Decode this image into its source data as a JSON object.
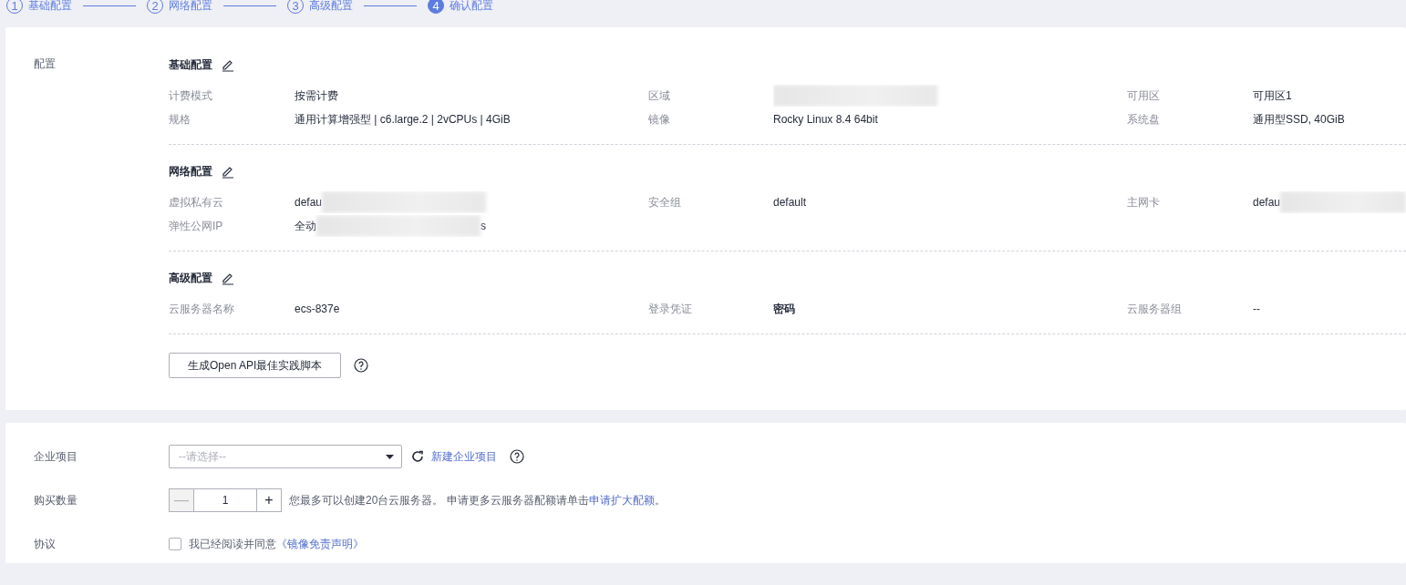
{
  "steps": [
    {
      "number": "1",
      "label": "基础配置",
      "selected": false
    },
    {
      "number": "2",
      "label": "网络配置",
      "selected": false
    },
    {
      "number": "3",
      "label": "高级配置",
      "selected": false
    },
    {
      "number": "4",
      "label": "确认配置",
      "selected": true
    }
  ],
  "config": {
    "label": "配置",
    "sections": [
      {
        "title": "基础配置",
        "rows": [
          [
            {
              "label": "计费模式",
              "value": "按需计费"
            },
            {
              "label": "区域",
              "redacted": true
            },
            {
              "label": "可用区",
              "value": "可用区1"
            }
          ],
          [
            {
              "label": "规格",
              "value": "通用计算增强型 | c6.large.2 | 2vCPUs | 4GiB"
            },
            {
              "label": "镜像",
              "value": "Rocky Linux 8.4 64bit"
            },
            {
              "label": "系统盘",
              "value": "通用型SSD, 40GiB"
            }
          ]
        ]
      },
      {
        "title": "网络配置",
        "rows": [
          [
            {
              "label": "虚拟私有云",
              "value": "defau",
              "redacted": true
            },
            {
              "label": "安全组",
              "value": "default"
            },
            {
              "label": "主网卡",
              "value": "defau",
              "redacted": true
            }
          ],
          [
            {
              "label": "弹性公网IP",
              "value": "全动",
              "redacted": true,
              "tail": "s"
            }
          ]
        ]
      },
      {
        "title": "高级配置",
        "rows": [
          [
            {
              "label": "云服务器名称",
              "value": "ecs-837e"
            },
            {
              "label": "登录凭证",
              "value": "密码",
              "bold": true
            },
            {
              "label": "云服务器组",
              "value": "--"
            }
          ]
        ]
      }
    ],
    "script_button": "生成Open API最佳实践脚本"
  },
  "enterprise_project": {
    "label": "企业项目",
    "placeholder": "--请选择--",
    "link": "新建企业项目"
  },
  "quantity": {
    "label": "购买数量",
    "minus": "—",
    "value": "1",
    "plus": "+",
    "note": "您最多可以创建20台云服务器。 申请更多云服务器配额请单击",
    "note_link": "申请扩大配额",
    "note_end": "。"
  },
  "agreement": {
    "label": "协议",
    "checked": false,
    "text": "我已经阅读并同意",
    "link": "《镜像免责声明》"
  }
}
